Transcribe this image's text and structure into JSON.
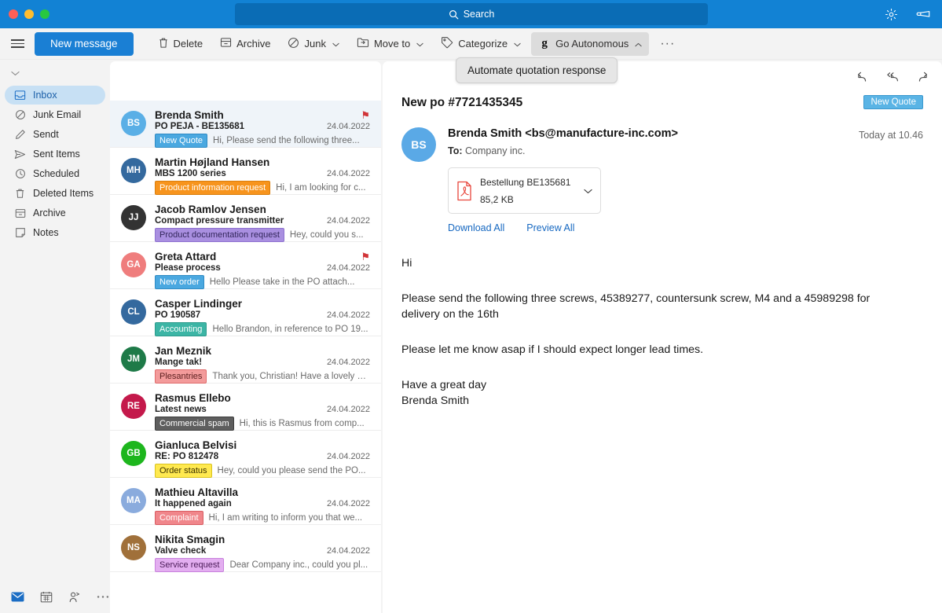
{
  "titlebar": {
    "search_placeholder": "Search",
    "settings_icon": "gear-icon",
    "feedback_icon": "megaphone-icon"
  },
  "ribbon": {
    "menu_icon": "hamburger-icon",
    "new_message": "New message",
    "commands": [
      {
        "label": "Delete",
        "icon": "trash-icon",
        "chevron": false
      },
      {
        "label": "Archive",
        "icon": "archive-icon",
        "chevron": false
      },
      {
        "label": "Junk",
        "icon": "block-icon",
        "chevron": true
      },
      {
        "label": "Move to",
        "icon": "folder-move-icon",
        "chevron": true
      },
      {
        "label": "Categorize",
        "icon": "tag-icon",
        "chevron": true
      }
    ],
    "autonomous": {
      "label": "Go Autonomous",
      "icon": "g-logo-icon",
      "chevron": "chevron-up-icon"
    },
    "overflow": "···",
    "dropdown_item": "Automate quotation response"
  },
  "sidebar": {
    "collapse_icon": "chevron-down-icon",
    "items": [
      {
        "label": "Inbox",
        "icon": "inbox-icon",
        "selected": true
      },
      {
        "label": "Junk Email",
        "icon": "block-icon",
        "selected": false
      },
      {
        "label": "Sendt",
        "icon": "pencil-icon",
        "selected": false
      },
      {
        "label": "Sent Items",
        "icon": "send-icon",
        "selected": false
      },
      {
        "label": "Scheduled",
        "icon": "clock-icon",
        "selected": false
      },
      {
        "label": "Deleted Items",
        "icon": "trash-icon",
        "selected": false
      },
      {
        "label": "Archive",
        "icon": "archive-icon",
        "selected": false
      },
      {
        "label": "Notes",
        "icon": "note-icon",
        "selected": false
      }
    ],
    "bottom_icons": [
      {
        "name": "mail-icon",
        "active": true
      },
      {
        "name": "calendar-icon",
        "active": false
      },
      {
        "name": "people-icon",
        "active": false
      },
      {
        "name": "more-icon",
        "active": false
      }
    ]
  },
  "messages": [
    {
      "initials": "BS",
      "color": "#5aafe6",
      "sender": "Brenda Smith",
      "subject": "PO PEJA - BE135681",
      "date": "24.04.2022",
      "category": "New Quote",
      "cat_bg": "#4aa8e0",
      "cat_fg": "#ffffff",
      "cat_border": "#2f8bc4",
      "preview": "Hi, Please send the following three...",
      "flagged": true,
      "selected": true
    },
    {
      "initials": "MH",
      "color": "#34699e",
      "sender": "Martin Højland Hansen",
      "subject": "MBS 1200 series",
      "date": "24.04.2022",
      "category": "Product information request",
      "cat_bg": "#f7941d",
      "cat_fg": "#ffffff",
      "cat_border": "#d97e0c",
      "preview": "Hi, I am looking for c...",
      "flagged": false,
      "selected": false
    },
    {
      "initials": "JJ",
      "color": "#333333",
      "sender": "Jacob Ramlov Jensen",
      "subject": "Compact pressure transmitter",
      "date": "24.04.2022",
      "category": "Product documentation request",
      "cat_bg": "#a98fe0",
      "cat_fg": "#33275c",
      "cat_border": "#8e71d0",
      "preview": "Hey, could you s...",
      "flagged": false,
      "selected": false
    },
    {
      "initials": "GA",
      "color": "#ef7d7d",
      "sender": "Greta Attard",
      "subject": "Please process",
      "date": "24.04.2022",
      "category": "New order",
      "cat_bg": "#4aa8e0",
      "cat_fg": "#ffffff",
      "cat_border": "#2f8bc4",
      "preview": "Hello Please take in the PO attach...",
      "flagged": true,
      "selected": false
    },
    {
      "initials": "CL",
      "color": "#34699e",
      "sender": "Casper Lindinger",
      "subject": "PO 190587",
      "date": "24.04.2022",
      "category": "Accounting",
      "cat_bg": "#3cb5a5",
      "cat_fg": "#ffffff",
      "cat_border": "#2c9a8c",
      "preview": "Hello Brandon, in reference to PO 19...",
      "flagged": false,
      "selected": false
    },
    {
      "initials": "JM",
      "color": "#1e7a48",
      "sender": "Jan Meznik",
      "subject": "Mange tak!",
      "date": "24.04.2022",
      "category": "Plesantries",
      "cat_bg": "#f39b9b",
      "cat_fg": "#5c1f1f",
      "cat_border": "#e06b6b",
      "preview": "Thank you, Christian! Have a lovely w...",
      "flagged": false,
      "selected": false
    },
    {
      "initials": "RE",
      "color": "#c4194b",
      "sender": "Rasmus Ellebo",
      "subject": "Latest news",
      "date": "24.04.2022",
      "category": "Commercial spam",
      "cat_bg": "#5e5e5e",
      "cat_fg": "#ffffff",
      "cat_border": "#3d3d3d",
      "preview": "Hi, this is Rasmus from comp...",
      "flagged": false,
      "selected": false
    },
    {
      "initials": "GB",
      "color": "#1db61d",
      "sender": "Gianluca Belvisi",
      "subject": "RE: PO 812478",
      "date": "24.04.2022",
      "category": "Order status",
      "cat_bg": "#ffe94f",
      "cat_fg": "#3d3300",
      "cat_border": "#d9c320",
      "preview": "Hey, could you please send the PO...",
      "flagged": false,
      "selected": false
    },
    {
      "initials": "MA",
      "color": "#8aabdd",
      "sender": "Mathieu Altavilla",
      "subject": "It happened again",
      "date": "24.04.2022",
      "category": "Complaint",
      "cat_bg": "#f0868b",
      "cat_fg": "#ffffff",
      "cat_border": "#d85c62",
      "preview": "Hi, I am writing to inform you that we...",
      "flagged": false,
      "selected": false
    },
    {
      "initials": "NS",
      "color": "#a0703a",
      "sender": "Nikita Smagin",
      "subject": "Valve check",
      "date": "24.04.2022",
      "category": "Service request",
      "cat_bg": "#e3aef0",
      "cat_fg": "#4b1b58",
      "cat_border": "#c881dd",
      "preview": "Dear Company inc., could you pl...",
      "flagged": false,
      "selected": false
    }
  ],
  "reading": {
    "subject": "New po #7721435345",
    "quote_badge": "New Quote",
    "avatar_initials": "BS",
    "from": "Brenda Smith <bs@manufacture-inc.com>",
    "to_label": "To:",
    "to_value": "Company inc.",
    "timestamp": "Today at 10.46",
    "attachment": {
      "name": "Bestellung BE135681",
      "size": "85,2 KB",
      "icon": "pdf-icon",
      "chevron": "chevron-down-icon"
    },
    "download_all": "Download All",
    "preview_all": "Preview All",
    "actions": [
      {
        "name": "reply-icon"
      },
      {
        "name": "reply-all-icon"
      },
      {
        "name": "forward-icon"
      }
    ],
    "body": {
      "greeting": "Hi",
      "paragraph1": "Please send the following three screws, 45389277, countersunk screw, M4 and a 45989298 for delivery on the 16th",
      "paragraph2": "Please let me know asap if I should expect longer lead times.",
      "closing": "Have a great day",
      "signature": "Brenda Smith"
    }
  },
  "colors": {
    "brand_blue": "#1282d4",
    "search_blue": "#0a6cb5",
    "accent_link": "#1668c1",
    "flag_red": "#d13438"
  }
}
